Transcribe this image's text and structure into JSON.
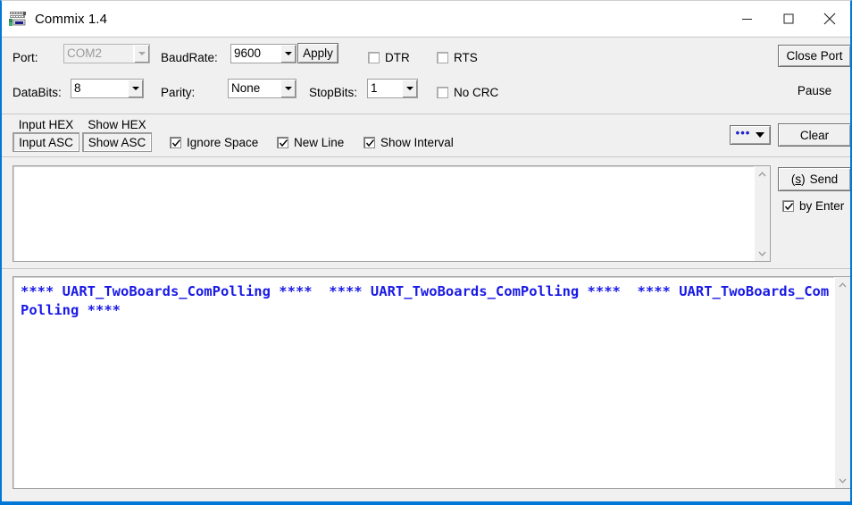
{
  "window": {
    "title": "Commix 1.4",
    "icon": "terminal-icon",
    "controls": {
      "minimize": "minimize-icon",
      "maximize": "maximize-icon",
      "close": "close-icon"
    },
    "accent_color": "#0078d7"
  },
  "settings": {
    "port": {
      "label": "Port:",
      "value": "COM2",
      "disabled": true
    },
    "baudrate": {
      "label": "BaudRate:",
      "value": "9600"
    },
    "apply_label": "Apply",
    "databits": {
      "label": "DataBits:",
      "value": "8"
    },
    "parity": {
      "label": "Parity:",
      "value": "None"
    },
    "stopbits": {
      "label": "StopBits:",
      "value": "1"
    },
    "dtr": {
      "label": "DTR",
      "checked": false
    },
    "rts": {
      "label": "RTS",
      "checked": false
    },
    "nocrc": {
      "label": "No CRC",
      "checked": false
    },
    "close_port_label": "Close Port",
    "pause_label": "Pause"
  },
  "format_bar": {
    "input_mode": {
      "hex_label": "Input HEX",
      "asc_label": "Input ASC",
      "selected": "Input ASC"
    },
    "show_mode": {
      "hex_label": "Show HEX",
      "asc_label": "Show ASC",
      "selected": "Show ASC"
    },
    "ignore_space": {
      "label": "Ignore Space",
      "checked": true
    },
    "new_line": {
      "label": "New Line",
      "checked": true
    },
    "show_interval": {
      "label": "Show Interval",
      "checked": true
    },
    "more_button": {
      "dots": "•••",
      "icon": "chevron-down-icon"
    },
    "clear_label": "Clear"
  },
  "send_area": {
    "value": "",
    "send_button": {
      "accelerator": "s",
      "label": "Send"
    },
    "by_enter": {
      "label": "by Enter",
      "checked": true
    }
  },
  "receive_area": {
    "text": "**** UART_TwoBoards_ComPolling ****  **** UART_TwoBoards_ComPolling ****  **** UART_TwoBoards_ComPolling ****",
    "text_color": "#1a1ae6"
  }
}
